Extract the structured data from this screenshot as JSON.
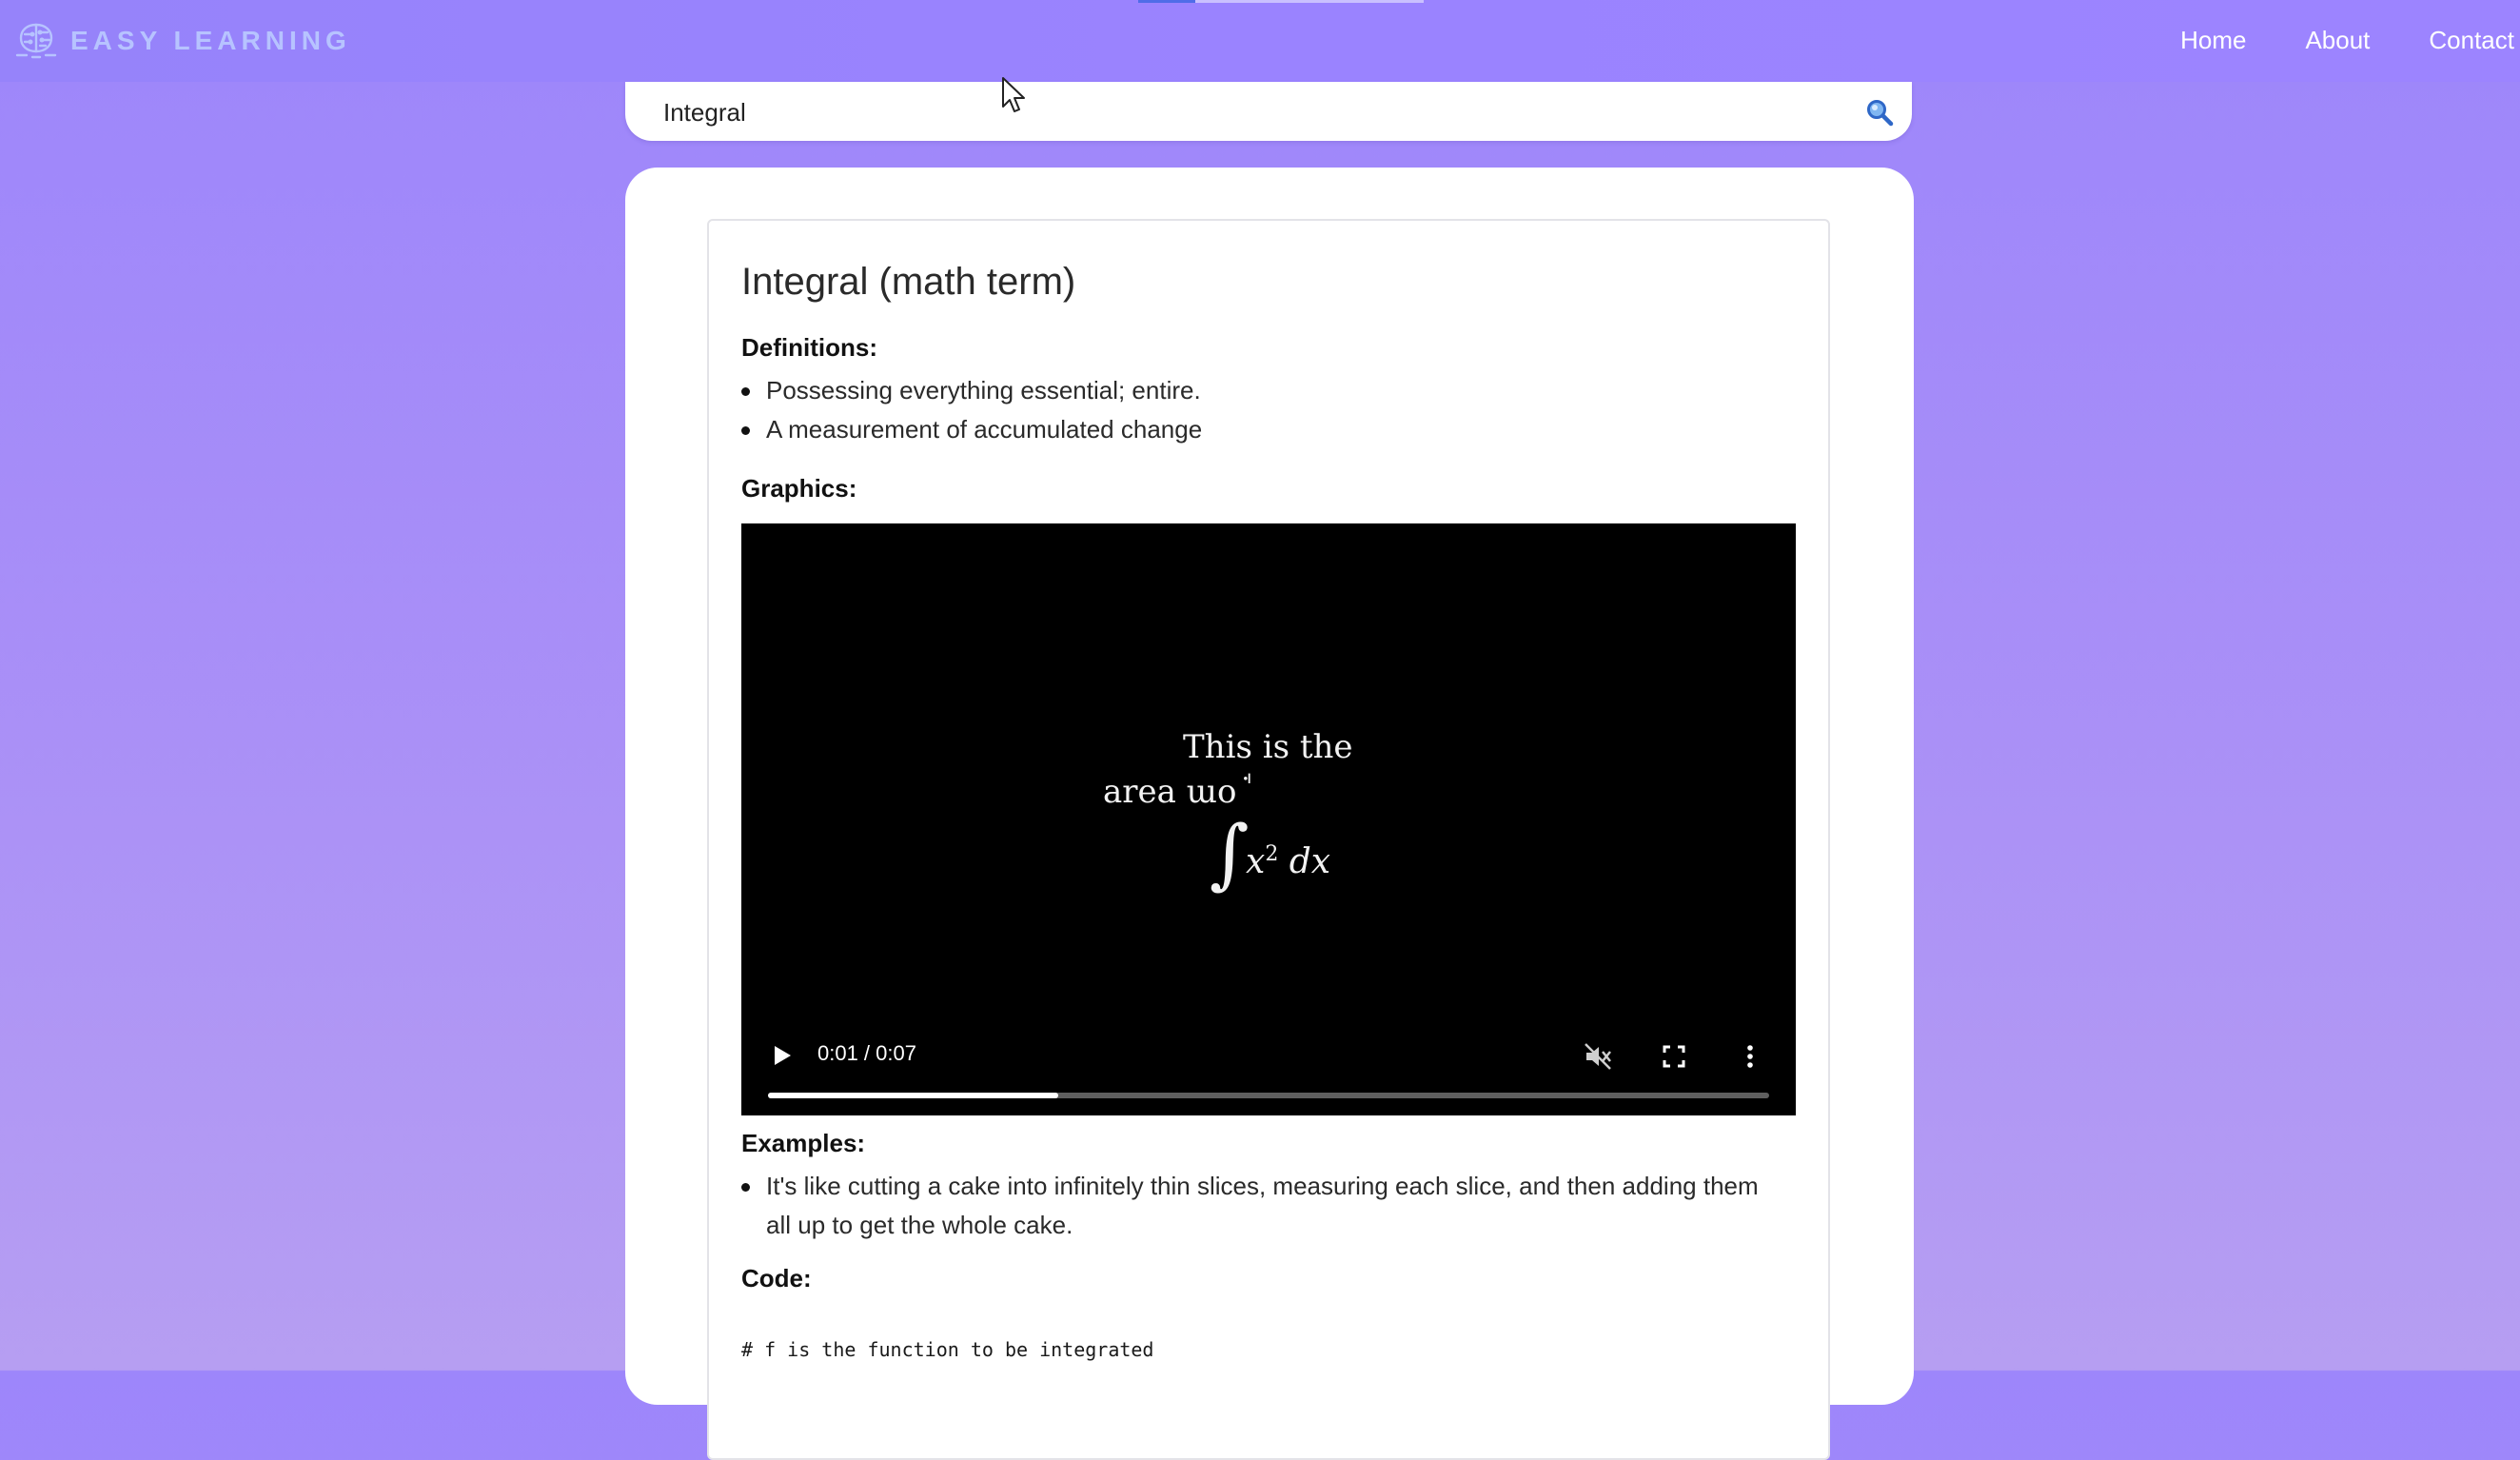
{
  "header": {
    "brand": "EASY LEARNING",
    "brand_logo_icon": "brain-circuit-icon",
    "nav": {
      "home": "Home",
      "about": "About",
      "contact": "Contact"
    },
    "colors": {
      "background": "#9a83ff",
      "brand_text": "#b7c3ff",
      "nav_text": "#ffffff"
    }
  },
  "search": {
    "value": "Integral",
    "button_icon": "search-icon"
  },
  "term": {
    "title": "Integral (math term)",
    "definitions_label": "Definitions:",
    "definitions": [
      "Possessing everything essential; entire.",
      "A measurement of accumulated change"
    ],
    "graphics_label": "Graphics:",
    "video": {
      "caption_line1": "This is the",
      "caption_line2": "area ɯo ꜗ",
      "integral_symbol": "∫",
      "expression_base": "x",
      "expression_exponent": "2",
      "expression_dx": " dx",
      "time_display": "0:01 / 0:07",
      "progress_fraction": 0.29,
      "play_icon": "play-icon",
      "mute_icon": "muted-speaker-icon",
      "fullscreen_icon": "fullscreen-icon",
      "more_icon": "more-vertical-icon"
    },
    "examples_label": "Examples:",
    "examples": [
      "It's like cutting a cake into infinitely thin slices, measuring each slice, and then adding them all up to get the whole cake."
    ],
    "code_label": "Code:",
    "code_line": "# f is the function to be integrated"
  },
  "colors": {
    "page_gradient_top": "#9d86fb",
    "page_gradient_bottom": "#b69ef2",
    "card_background": "#ffffff",
    "video_background": "#000000"
  }
}
